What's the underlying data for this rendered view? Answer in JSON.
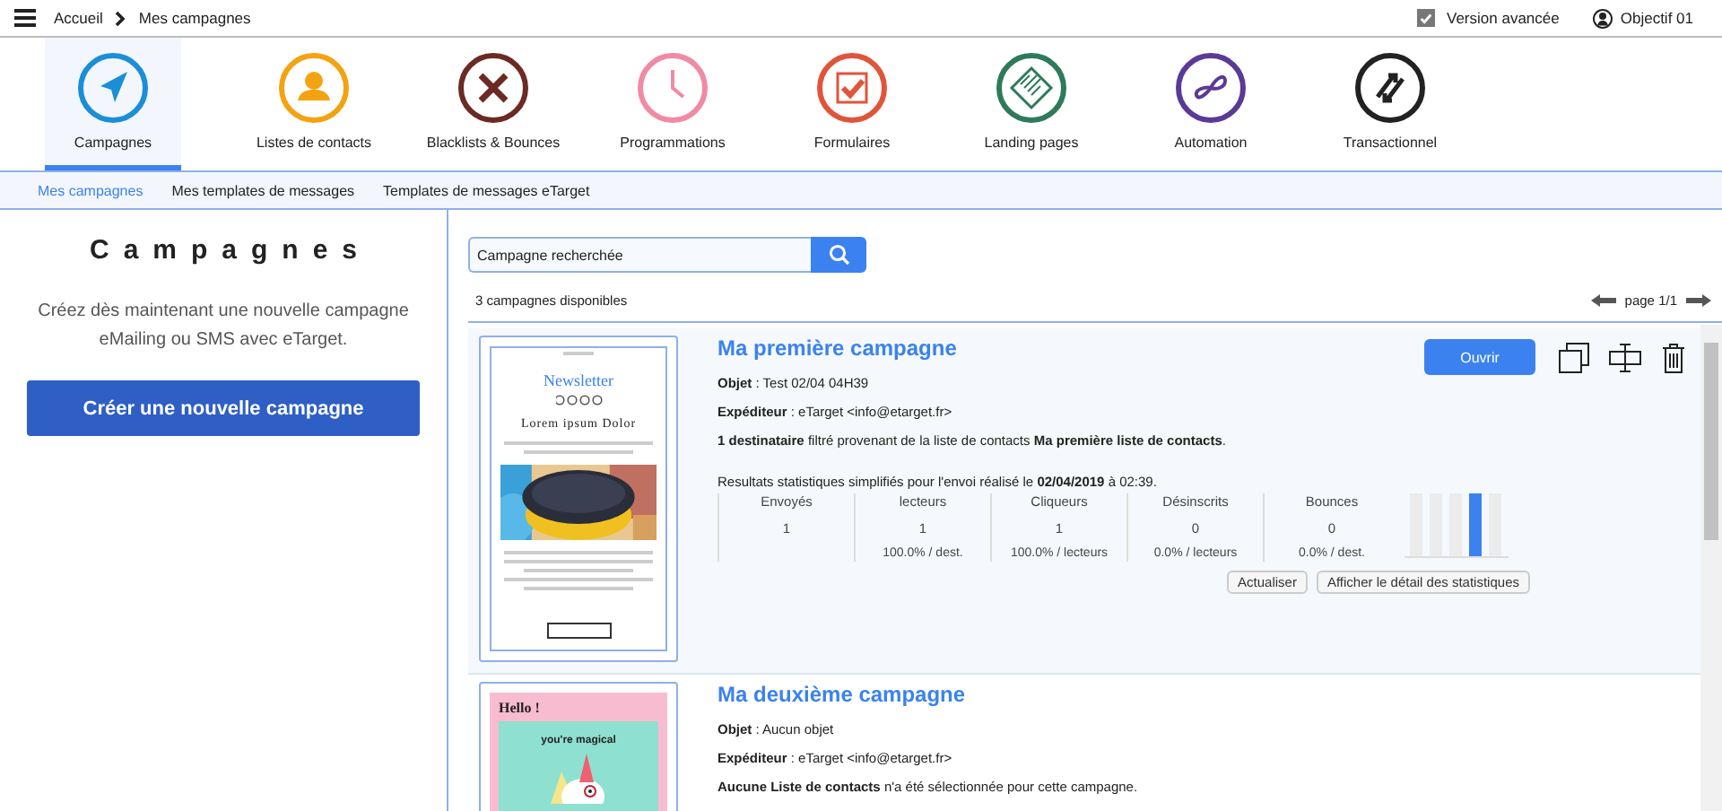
{
  "breadcrumb": [
    "Accueil",
    "Mes campagnes"
  ],
  "top_right": {
    "advanced_version": {
      "label": "Version avancée",
      "checked": true
    },
    "account": "Objectif 01"
  },
  "nav": [
    {
      "label": "Campagnes",
      "kind": "send",
      "color": "#1a8fd8",
      "selected": true
    },
    {
      "label": "Listes de contacts",
      "kind": "person",
      "color": "#f3a312",
      "selected": false
    },
    {
      "label": "Blacklists & Bounces",
      "kind": "cross",
      "color": "#6b2a22",
      "selected": false
    },
    {
      "label": "Programmations",
      "kind": "clock",
      "color": "#f08aa5",
      "selected": false
    },
    {
      "label": "Formulaires",
      "kind": "check",
      "color": "#e0553a",
      "selected": false
    },
    {
      "label": "Landing pages",
      "kind": "page",
      "color": "#2e7a5a",
      "selected": false
    },
    {
      "label": "Automation",
      "kind": "infinity",
      "color": "#5b3a96",
      "selected": false
    },
    {
      "label": "Transactionnel",
      "kind": "exchange",
      "color": "#222222",
      "selected": false
    }
  ],
  "subnav": [
    {
      "label": "Mes campagnes",
      "selected": true
    },
    {
      "label": "Mes templates de messages",
      "selected": false
    },
    {
      "label": "Templates de messages eTarget",
      "selected": false
    }
  ],
  "left_panel": {
    "title": "Campagnes",
    "text": "Créez dès maintenant une nouvelle campagne eMailing ou SMS avec eTarget.",
    "button": "Créer une nouvelle campagne"
  },
  "search": {
    "placeholder": "Campagne recherchée"
  },
  "count": "3 campagnes disponibles",
  "pager": "page 1/1",
  "campaigns": [
    {
      "kind": "newsletter",
      "preview": {
        "title": "Newsletter",
        "heading": "Lorem ipsum Dolor"
      },
      "title": "Ma première campagne",
      "subject": "**Objet** : Test 02/04 04H39",
      "sender": "**Expéditeur** : eTarget <info@etarget.fr>",
      "recipients": "**1 destinataire** filtré provenant de la liste de contacts **Ma première liste de contacts**.",
      "open_button": "Ouvrir",
      "stats_intro": "Resultats statistiques simplifiés pour l'envoi réalisé le **02/04/2019** à 02:39.",
      "stats": [
        {
          "label": "Envoyés",
          "value": "1"
        },
        {
          "label": "lecteurs",
          "value": "1",
          "rate": "100.0% / dest."
        },
        {
          "label": "Cliqueurs",
          "value": "1",
          "rate": "100.0% / lecteurs"
        },
        {
          "label": "Désinscrits",
          "value": "0",
          "rate": "0.0% / lecteurs"
        },
        {
          "label": "Bounces",
          "value": "0",
          "rate": "0.0% / dest."
        }
      ],
      "actions": [
        "Actualiser",
        "Afficher le détail des statistiques"
      ]
    },
    {
      "kind": "card",
      "preview": {
        "title": "Hello !",
        "heading": "you're magical"
      },
      "title": "Ma deuxième campagne",
      "subject": "**Objet** : Aucun objet",
      "sender": "**Expéditeur** : eTarget <info@etarget.fr>",
      "recipients": "**Aucune Liste de contacts** n'a été sélectionnée pour cette campagne."
    }
  ]
}
